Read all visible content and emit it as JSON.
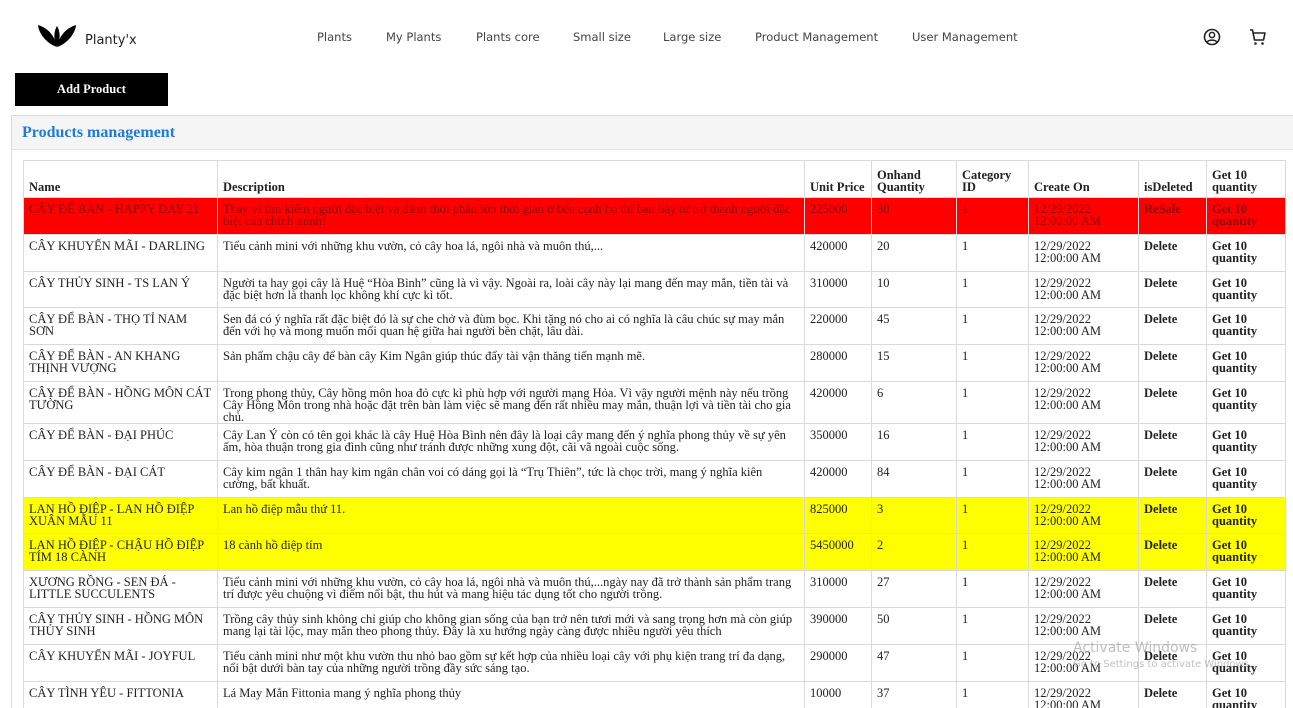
{
  "brand": {
    "name": "Planty'x"
  },
  "nav": {
    "items": [
      {
        "label": "Plants"
      },
      {
        "label": "My Plants"
      },
      {
        "label": "Plants core"
      },
      {
        "label": "Small size"
      },
      {
        "label": "Large size"
      },
      {
        "label": "Product Management"
      },
      {
        "label": "User Management"
      }
    ]
  },
  "icons": {
    "user": "user-icon",
    "cart": "cart-icon"
  },
  "actions": {
    "add_product": "Add Product"
  },
  "card": {
    "title": "Products management"
  },
  "colors": {
    "title_blue": "#1f7bd6",
    "highlight_red": "#ff0000",
    "highlight_yellow": "#ffff00"
  },
  "table": {
    "headers": {
      "name": "Name",
      "description": "Description",
      "unit_price": "Unit Price",
      "onhand_quantity": "Onhand Quantity",
      "category_id": "Category ID",
      "create_on": "Create On",
      "is_deleted": "isDeleted",
      "get_quantity": "Get 10 quantity"
    },
    "rows": [
      {
        "highlight": "red",
        "name": "CÂY ĐỂ BÀN - HAPPY DAY 21",
        "description": "Thay vì tìm kiếm người đặc biệt và dành thời phần lớn thời gian ở bên cạnh họ thì bạn hãy tự trở thành người đặc biệt của chính mình!",
        "unit_price": "225000",
        "onhand_quantity": "30",
        "category_id": "1",
        "create_on": "12/29/2022 12:00:00 AM",
        "is_deleted": "ReSale",
        "get_quantity": "Get 10 quantity"
      },
      {
        "highlight": "",
        "name": "CÂY KHUYẾN MÃI - DARLING",
        "description": "Tiểu cảnh mini với những khu vườn, cỏ cây hoa lá, ngôi nhà và muôn thú,...",
        "unit_price": "420000",
        "onhand_quantity": "20",
        "category_id": "1",
        "create_on": "12/29/2022 12:00:00 AM",
        "is_deleted": "Delete",
        "get_quantity": "Get 10 quantity"
      },
      {
        "highlight": "",
        "name": "CÂY THỦY SINH - TS LAN Ý",
        "description": "Người ta hay gọi cây là Huệ “Hòa Bình” cũng là vì vậy. Ngoài ra, loài cây này lại mang đến may mắn, tiền tài và đặc biệt hơn là thanh lọc không khí cực kì tốt.",
        "unit_price": "310000",
        "onhand_quantity": "10",
        "category_id": "1",
        "create_on": "12/29/2022 12:00:00 AM",
        "is_deleted": "Delete",
        "get_quantity": "Get 10 quantity"
      },
      {
        "highlight": "",
        "name": "CÂY ĐỂ BÀN - THỌ TỈ NAM SƠN",
        "description": "Sen đá có ý nghĩa rất đặc biệt đó là sự che chở và đùm bọc. Khi tặng nó cho ai có nghĩa là câu chúc sự may mắn đến với họ và mong muốn mối quan hệ giữa hai người bền chặt, lâu dài.",
        "unit_price": "220000",
        "onhand_quantity": "45",
        "category_id": "1",
        "create_on": "12/29/2022 12:00:00 AM",
        "is_deleted": "Delete",
        "get_quantity": "Get 10 quantity"
      },
      {
        "highlight": "",
        "name": "CÂY ĐỂ BÀN - AN KHANG THỊNH VƯỢNG",
        "description": "Sản phẩm chậu cây để bàn cây Kim Ngân giúp thúc đẩy tài vận thăng tiến mạnh mẽ.",
        "unit_price": "280000",
        "onhand_quantity": "15",
        "category_id": "1",
        "create_on": "12/29/2022 12:00:00 AM",
        "is_deleted": "Delete",
        "get_quantity": "Get 10 quantity"
      },
      {
        "highlight": "",
        "name": "CÂY ĐỂ BÀN - HỒNG MÔN CÁT TƯỜNG",
        "description": "Trong phong thủy, Cây hồng môn hoa đỏ cực kì phù hợp với người mạng Hỏa. Vì vậy người mệnh này nếu trồng Cây Hồng Môn trong nhà hoặc đặt trên bàn làm việc sẽ mang đến rất nhiều may mắn, thuận lợi và tiền tài cho gia chủ.",
        "unit_price": "420000",
        "onhand_quantity": "6",
        "category_id": "1",
        "create_on": "12/29/2022 12:00:00 AM",
        "is_deleted": "Delete",
        "get_quantity": "Get 10 quantity"
      },
      {
        "highlight": "",
        "name": "CÂY ĐỂ BÀN - ĐẠI PHÚC",
        "description": "Cây Lan Ý còn có tên gọi khác là cây Huệ Hòa Bình nên đây là loại cây mang đến ý nghĩa phong thủy về sự yên ấm, hòa thuận trong gia đình cũng như tránh được những xung đột, cãi vã ngoài cuộc sống.",
        "unit_price": "350000",
        "onhand_quantity": "16",
        "category_id": "1",
        "create_on": "12/29/2022 12:00:00 AM",
        "is_deleted": "Delete",
        "get_quantity": "Get 10 quantity"
      },
      {
        "highlight": "",
        "name": "CÂY ĐỂ BÀN - ĐẠI CÁT",
        "description": "Cây kim ngân 1 thân hay kim ngân chân voi có dáng gọi là “Trụ Thiên”, tức là chọc trời, mang ý nghĩa kiên cường, bất khuất.",
        "unit_price": "420000",
        "onhand_quantity": "84",
        "category_id": "1",
        "create_on": "12/29/2022 12:00:00 AM",
        "is_deleted": "Delete",
        "get_quantity": "Get 10 quantity"
      },
      {
        "highlight": "yellow",
        "name": "LAN HỒ ĐIỆP - LAN HỒ ĐIỆP XUÂN MẪU 11",
        "description": "Lan hồ điệp mẫu thứ 11.",
        "unit_price": "825000",
        "onhand_quantity": "3",
        "category_id": "1",
        "create_on": "12/29/2022 12:00:00 AM",
        "is_deleted": "Delete",
        "get_quantity": "Get 10 quantity"
      },
      {
        "highlight": "yellow",
        "name": "LAN HỒ ĐIỆP - CHẬU HỒ ĐIỆP TÍM 18 CÀNH",
        "description": "18 cành hồ điệp tím",
        "unit_price": "5450000",
        "onhand_quantity": "2",
        "category_id": "1",
        "create_on": "12/29/2022 12:00:00 AM",
        "is_deleted": "Delete",
        "get_quantity": "Get 10 quantity"
      },
      {
        "highlight": "",
        "name": "XƯƠNG RỒNG - SEN ĐÁ - LITTLE SUCCULENTS",
        "description": "Tiểu cảnh mini với những khu vườn, cỏ cây hoa lá, ngôi nhà và muôn thú,...ngày nay đã trở thành sản phẩm trang trí được yêu chuộng vì điểm nổi bật, thu hút và mang hiệu tác dụng tốt cho người trồng.",
        "unit_price": "310000",
        "onhand_quantity": "27",
        "category_id": "1",
        "create_on": "12/29/2022 12:00:00 AM",
        "is_deleted": "Delete",
        "get_quantity": "Get 10 quantity"
      },
      {
        "highlight": "",
        "name": "CÂY THỦY SINH - HỒNG MÔN THỦY SINH",
        "description": "Trồng cây thủy sinh không chỉ giúp cho không gian sống của bạn trở nên tươi mới và sang trọng hơn mà còn giúp mang lại tài lộc, may mắn theo phong thủy. Đây là xu hướng ngày càng được nhiều người yêu thích",
        "unit_price": "390000",
        "onhand_quantity": "50",
        "category_id": "1",
        "create_on": "12/29/2022 12:00:00 AM",
        "is_deleted": "Delete",
        "get_quantity": "Get 10 quantity"
      },
      {
        "highlight": "",
        "name": "CÂY KHUYẾN MÃI - JOYFUL",
        "description": "Tiểu cảnh mini như một khu vườn thu nhỏ bao gồm sự kết hợp của nhiều loại cây với phụ kiện trang trí đa dạng, nổi bật dưới bàn tay của những người trồng đầy sức sáng tạo.",
        "unit_price": "290000",
        "onhand_quantity": "47",
        "category_id": "1",
        "create_on": "12/29/2022 12:00:00 AM",
        "is_deleted": "Delete",
        "get_quantity": "Get 10 quantity"
      },
      {
        "highlight": "",
        "name": "CÂY TÌNH YÊU - FITTONIA",
        "description": "Lá May Mắn Fittonia mang ý nghĩa phong thủy",
        "unit_price": "10000",
        "onhand_quantity": "37",
        "category_id": "1",
        "create_on": "12/29/2022 12:00:00 AM",
        "is_deleted": "Delete",
        "get_quantity": "Get 10 quantity"
      }
    ]
  },
  "watermark": {
    "line1": "Activate Windows",
    "line2": "Go to Settings to activate Windows."
  }
}
